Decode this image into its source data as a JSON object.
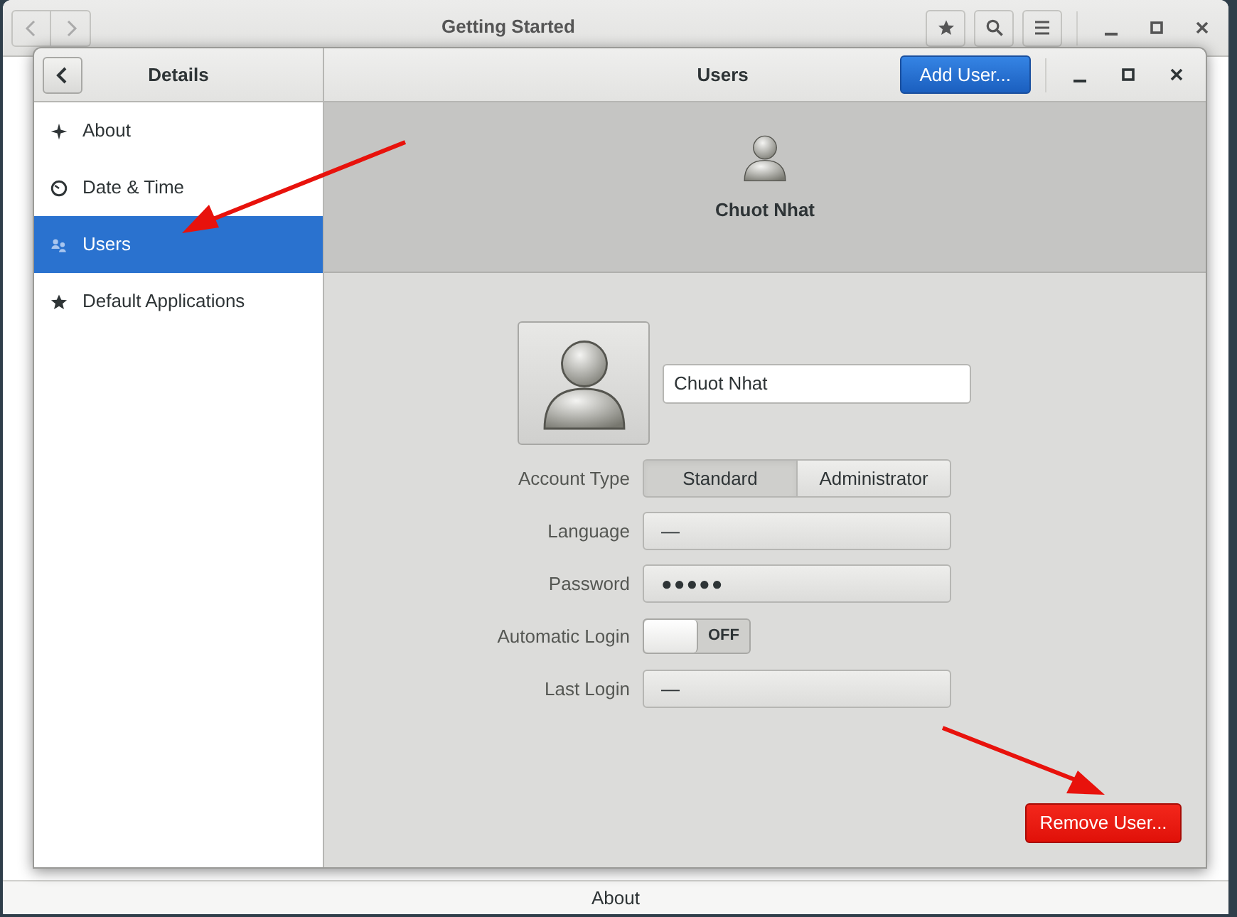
{
  "background_window": {
    "title": "Getting Started",
    "footer": "About"
  },
  "dialog": {
    "sidebar_title": "Details",
    "title": "Users",
    "add_button": "Add User..."
  },
  "sidebar": {
    "items": [
      {
        "label": "About",
        "selected": false
      },
      {
        "label": "Date & Time",
        "selected": false
      },
      {
        "label": "Users",
        "selected": true
      },
      {
        "label": "Default Applications",
        "selected": false
      }
    ]
  },
  "user_header": {
    "name": "Chuot Nhat"
  },
  "form": {
    "name_field": {
      "value": "Chuot Nhat"
    },
    "rows": [
      {
        "kind": "segmented",
        "label": "Account Type",
        "options": [
          {
            "label": "Standard",
            "selected": true
          },
          {
            "label": "Administrator",
            "selected": false
          }
        ]
      },
      {
        "kind": "button",
        "label": "Language",
        "value": "—"
      },
      {
        "kind": "password",
        "label": "Password",
        "value": "●●●●●"
      },
      {
        "kind": "switch",
        "label": "Automatic Login",
        "on": false,
        "state_label": "OFF"
      },
      {
        "kind": "button",
        "label": "Last Login",
        "value": "—"
      }
    ]
  },
  "remove_button": "Remove User..."
}
